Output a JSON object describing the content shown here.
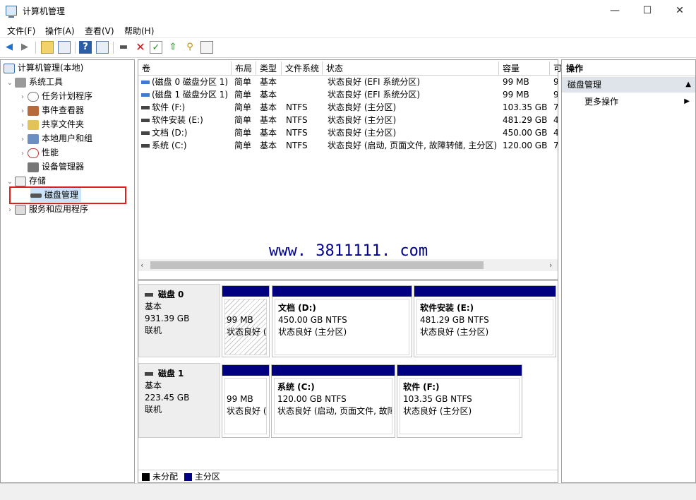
{
  "window": {
    "title": "计算机管理",
    "controls": [
      "—",
      "☐",
      "✕"
    ]
  },
  "menu": [
    "文件(F)",
    "操作(A)",
    "查看(V)",
    "帮助(H)"
  ],
  "tree": {
    "root": "计算机管理(本地)",
    "system_tools": "系统工具",
    "task_scheduler": "任务计划程序",
    "event_viewer": "事件查看器",
    "shared_folders": "共享文件夹",
    "local_users": "本地用户和组",
    "performance": "性能",
    "device_manager": "设备管理器",
    "storage": "存储",
    "disk_management": "磁盘管理",
    "services_apps": "服务和应用程序"
  },
  "volume_table": {
    "columns": [
      "卷",
      "布局",
      "类型",
      "文件系统",
      "状态",
      "容量",
      "可"
    ],
    "rows": [
      {
        "vol": "(磁盘 0 磁盘分区 1)",
        "layout": "简单",
        "type": "基本",
        "fs": "",
        "status": "状态良好 (EFI 系统分区)",
        "capacity": "99 MB",
        "free": "9"
      },
      {
        "vol": "(磁盘 1 磁盘分区 1)",
        "layout": "简单",
        "type": "基本",
        "fs": "",
        "status": "状态良好 (EFI 系统分区)",
        "capacity": "99 MB",
        "free": "9"
      },
      {
        "vol": "软件 (F:)",
        "layout": "简单",
        "type": "基本",
        "fs": "NTFS",
        "status": "状态良好 (主分区)",
        "capacity": "103.35 GB",
        "free": "7"
      },
      {
        "vol": "软件安装 (E:)",
        "layout": "简单",
        "type": "基本",
        "fs": "NTFS",
        "status": "状态良好 (主分区)",
        "capacity": "481.29 GB",
        "free": "4"
      },
      {
        "vol": "文档 (D:)",
        "layout": "简单",
        "type": "基本",
        "fs": "NTFS",
        "status": "状态良好 (主分区)",
        "capacity": "450.00 GB",
        "free": "4"
      },
      {
        "vol": "系统 (C:)",
        "layout": "简单",
        "type": "基本",
        "fs": "NTFS",
        "status": "状态良好 (启动, 页面文件, 故障转储, 主分区)",
        "capacity": "120.00 GB",
        "free": "7"
      }
    ]
  },
  "watermark": "www. 3811111. com",
  "disks": [
    {
      "name": "磁盘 0",
      "type": "基本",
      "size": "931.39 GB",
      "state": "联机",
      "partitions": [
        {
          "title": "",
          "size": "99 MB",
          "status": "状态良好 ("
        },
        {
          "title": "文档  (D:)",
          "size": "450.00 GB NTFS",
          "status": "状态良好 (主分区)"
        },
        {
          "title": "软件安装  (E:)",
          "size": "481.29 GB NTFS",
          "status": "状态良好 (主分区)"
        }
      ]
    },
    {
      "name": "磁盘 1",
      "type": "基本",
      "size": "223.45 GB",
      "state": "联机",
      "partitions": [
        {
          "title": "",
          "size": "99 MB",
          "status": "状态良好 ("
        },
        {
          "title": "系统  (C:)",
          "size": "120.00 GB NTFS",
          "status": "状态良好 (启动, 页面文件, 故障"
        },
        {
          "title": "软件  (F:)",
          "size": "103.35 GB NTFS",
          "status": "状态良好 (主分区)"
        }
      ]
    }
  ],
  "legend": {
    "unallocated": "未分配",
    "primary": "主分区"
  },
  "actions": {
    "header": "操作",
    "section": "磁盘管理",
    "more": "更多操作"
  },
  "colors": {
    "primary_partition": "#000080",
    "highlight": "#e0201b",
    "unallocated": "#000000"
  }
}
